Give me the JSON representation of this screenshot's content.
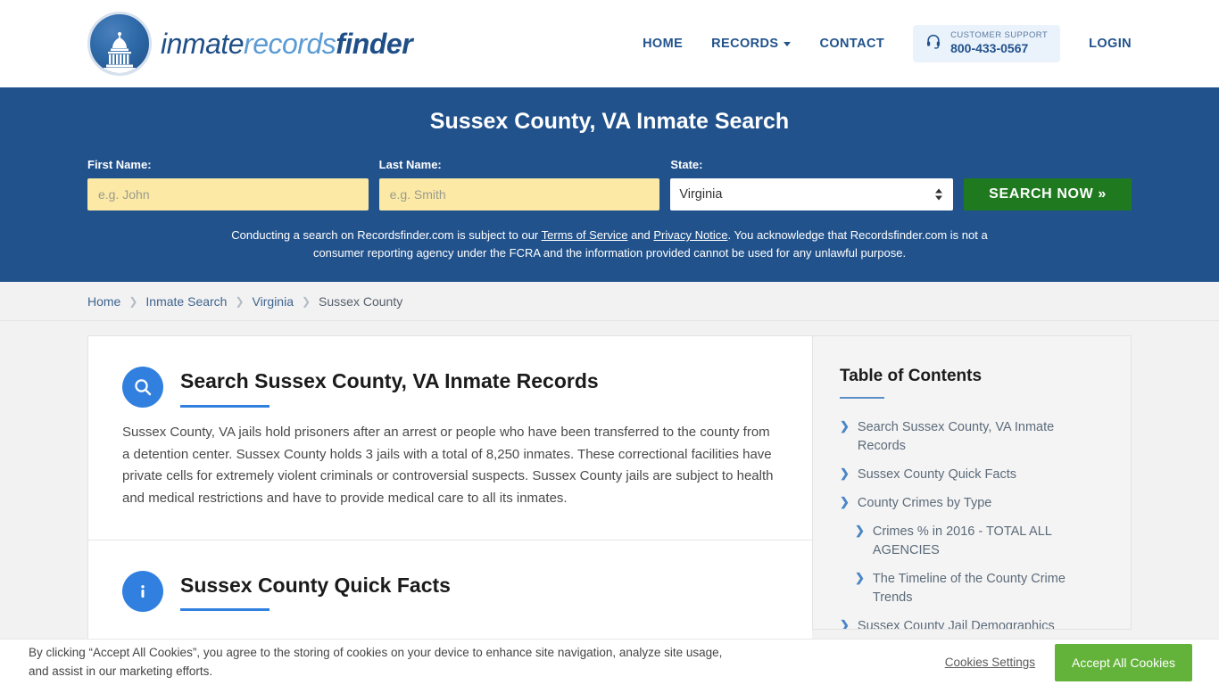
{
  "header": {
    "logo": {
      "part1": "inmate",
      "part2": "records",
      "part3": "finder",
      "icon": "capitol-dome-icon"
    },
    "nav": [
      {
        "label": "HOME",
        "has_dropdown": false
      },
      {
        "label": "RECORDS",
        "has_dropdown": true
      },
      {
        "label": "CONTACT",
        "has_dropdown": false
      }
    ],
    "support": {
      "icon": "headset-icon",
      "label": "CUSTOMER SUPPORT",
      "phone": "800-433-0567"
    },
    "login_label": "LOGIN"
  },
  "hero": {
    "title": "Sussex County, VA Inmate Search",
    "accent_color": "#21528c",
    "fields": {
      "first_name_label": "First Name:",
      "first_name_placeholder": "e.g. John",
      "first_name_value": "",
      "last_name_label": "Last Name:",
      "last_name_placeholder": "e.g. Smith",
      "last_name_value": "",
      "state_label": "State:",
      "state_value": "Virginia",
      "state_options": [
        "Virginia"
      ]
    },
    "search_button_label": "SEARCH NOW »",
    "search_button_color": "#1f7a1f",
    "disclaimer": {
      "part1": "Conducting a search on Recordsfinder.com is subject to our ",
      "link1": "Terms of Service",
      "part2": " and ",
      "link2": "Privacy Notice",
      "part3": ". You acknowledge that Recordsfinder.com is not a consumer reporting agency under the FCRA and the information provided cannot be used for any unlawful purpose."
    }
  },
  "breadcrumb": [
    {
      "label": "Home",
      "current": false
    },
    {
      "label": "Inmate Search",
      "current": false
    },
    {
      "label": "Virginia",
      "current": false
    },
    {
      "label": "Sussex County",
      "current": true
    }
  ],
  "main": {
    "sections": [
      {
        "icon": "search-circle-icon",
        "title": "Search Sussex County, VA Inmate Records",
        "body": "Sussex County, VA jails hold prisoners after an arrest or people who have been transferred to the county from a detention center. Sussex County holds 3 jails with a total of 8,250 inmates. These correctional facilities have private cells for extremely violent criminals or controversial suspects. Sussex County jails are subject to health and medical restrictions and have to provide medical care to all its inmates."
      },
      {
        "icon": "info-circle-icon",
        "title": "Sussex County Quick Facts",
        "body": ""
      }
    ]
  },
  "toc": {
    "title": "Table of Contents",
    "items": [
      {
        "label": "Search Sussex County, VA Inmate Records",
        "sub": false
      },
      {
        "label": "Sussex County Quick Facts",
        "sub": false
      },
      {
        "label": "County Crimes by Type",
        "sub": false
      },
      {
        "label": "Crimes % in 2016 - TOTAL ALL AGENCIES",
        "sub": true
      },
      {
        "label": "The Timeline of the County Crime Trends",
        "sub": true
      },
      {
        "label": "Sussex County Jail Demographics",
        "sub": false
      }
    ]
  },
  "cookie_banner": {
    "text": "By clicking “Accept All Cookies”, you agree to the storing of cookies on your device to enhance site navigation, analyze site usage, and assist in our marketing efforts.",
    "settings_label": "Cookies Settings",
    "accept_label": "Accept All Cookies",
    "accept_color": "#63b33b"
  }
}
